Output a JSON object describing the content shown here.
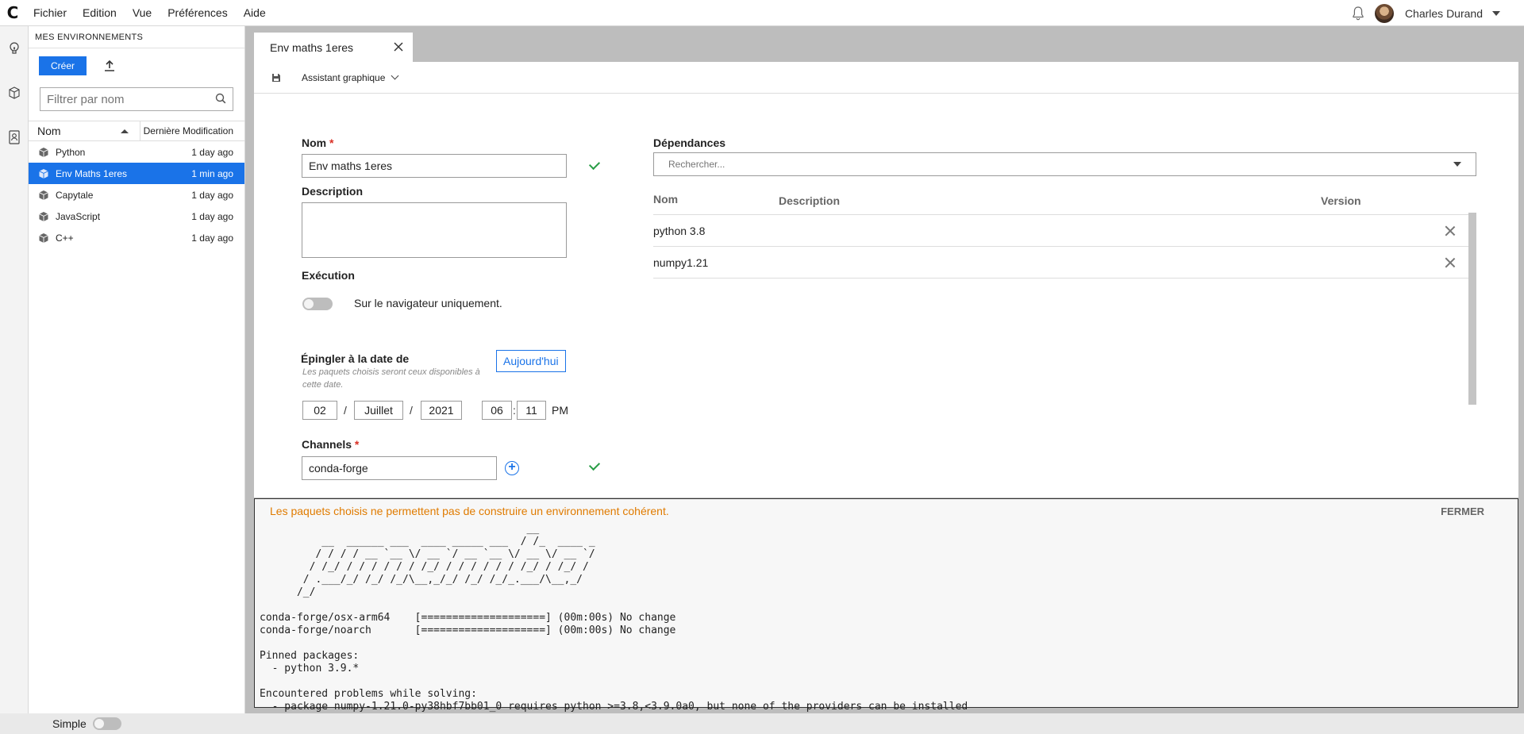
{
  "app": {
    "logo_text": "C",
    "menu": [
      "Fichier",
      "Edition",
      "Vue",
      "Préférences",
      "Aide"
    ],
    "user": {
      "name": "Charles Durand"
    }
  },
  "rail": {
    "icons": [
      "lightbulb-icon",
      "cube-icon",
      "contacts-icon"
    ]
  },
  "sidebar": {
    "title": "MES  ENVIRONNEMENTS",
    "create_label": "Créer",
    "filter_placeholder": "Filtrer par nom",
    "col_name": "Nom",
    "col_date": "Dernière Modification",
    "items": [
      {
        "name": "Python",
        "date": "1 day ago",
        "selected": false
      },
      {
        "name": "Env Maths 1eres",
        "date": "1 min ago",
        "selected": true
      },
      {
        "name": "Capytale",
        "date": "1 day ago",
        "selected": false
      },
      {
        "name": "JavaScript",
        "date": "1 day ago",
        "selected": false
      },
      {
        "name": "C++",
        "date": "1 day ago",
        "selected": false
      }
    ]
  },
  "tab": {
    "label": "Env maths 1eres"
  },
  "toolbar": {
    "assistant_label": "Assistant graphique"
  },
  "form": {
    "name_label": "Nom",
    "name_value": "Env maths 1eres",
    "required_mark": "*",
    "description_label": "Description",
    "description_value": "",
    "execution_label": "Exécution",
    "execution_toggle_text": "Sur le navigateur uniquement.",
    "execution_enabled": false,
    "pin_label": "Épingler à la date de",
    "pin_hint": "Les paquets choisis seront ceux disponibles à cette date.",
    "today_button": "Aujourd'hui",
    "date": {
      "day": "02",
      "month": "Juillet",
      "year": "2021",
      "hour": "06",
      "minute": "11",
      "ampm": "PM",
      "slash": "/",
      "colon": ":"
    },
    "channels_label": "Channels",
    "channel_value": "conda-forge"
  },
  "dependencies": {
    "label": "Dépendances",
    "search_placeholder": "Rechercher...",
    "col_name": "Nom",
    "col_description": "Description",
    "col_version": "Version",
    "rows": [
      {
        "name": "python 3.8"
      },
      {
        "name": "numpy1.21"
      }
    ]
  },
  "console": {
    "message": "Les paquets choisis ne permettent pas de construire un environnement cohérent.",
    "close_label": "FERMER",
    "output": "                                           __\n          __  ______ ___  ____ _____ ___  / /_  ____ _\n         / / / / __ `__ \\/ __ `/ __ `__ \\/ __ \\/ __ `/\n        / /_/ / / / / / / /_/ / / / / / / /_/ / /_/ /\n       / .___/_/ /_/ /_/\\__,_/_/ /_/ /_/_.___/\\__,_/\n      /_/\n\nconda-forge/osx-arm64    [====================] (00m:00s) No change\nconda-forge/noarch       [====================] (00m:00s) No change\n\nPinned packages:\n  - python 3.9.*\n\nEncountered problems while solving:\n  - package numpy-1.21.0-py38hbf7bb01_0 requires python >=3.8,<3.9.0a0, but none of the providers can be installed"
  },
  "statusbar": {
    "mode_label": "Simple",
    "mode_enabled": false
  },
  "colors": {
    "accent": "#1a73e8",
    "warning": "#e07b00",
    "success": "#2a9d47",
    "required": "#d93025"
  }
}
